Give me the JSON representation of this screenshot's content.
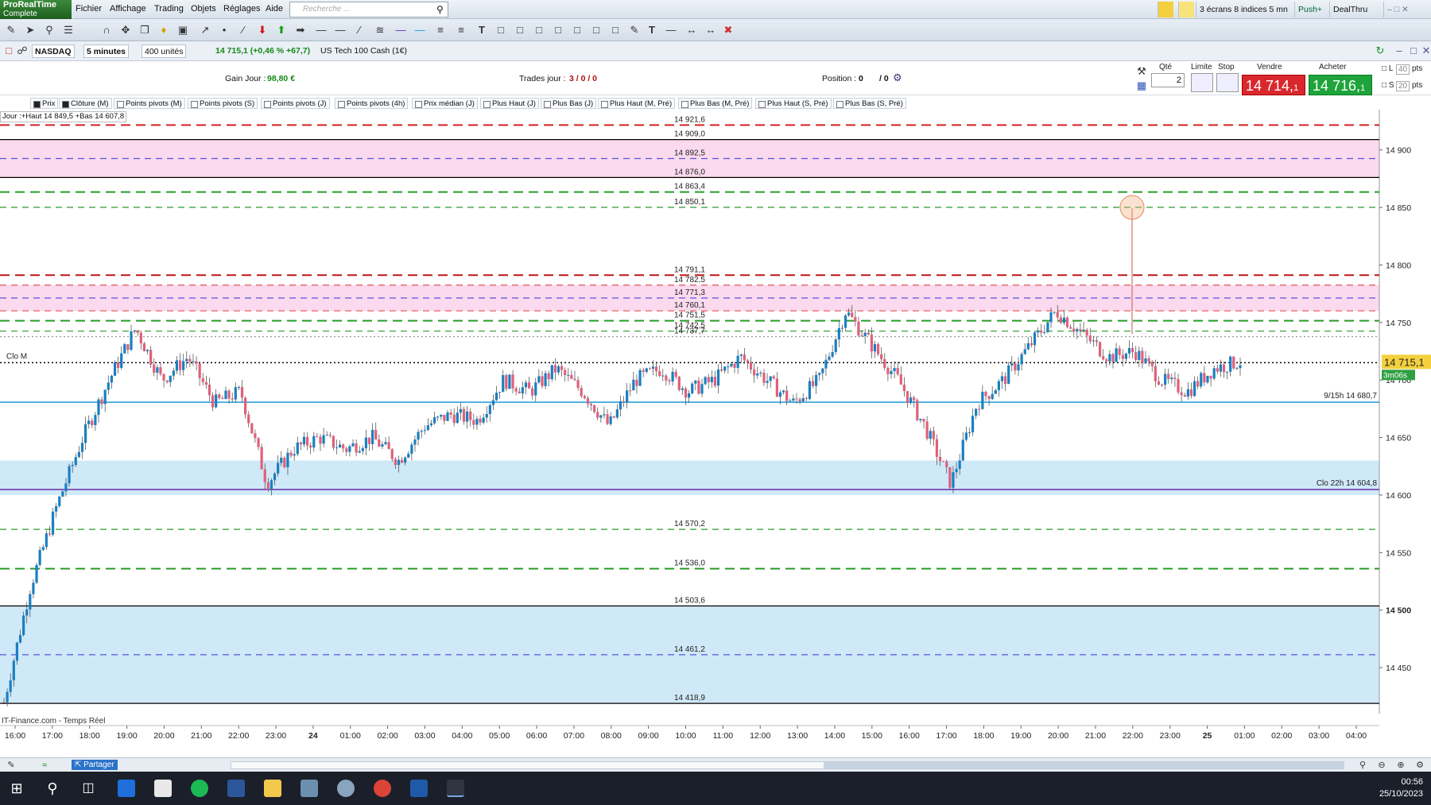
{
  "app": {
    "brand": "ProRealTime",
    "edition": "Complete"
  },
  "menu": [
    "Fichier",
    "Affichage",
    "Trading",
    "Objets",
    "Réglages",
    "Aide"
  ],
  "search": {
    "placeholder": "Recherche ..."
  },
  "topright": {
    "layout": "3 écrans 8 indices 5 mn",
    "push": "Push+",
    "dealthru": "DealThru"
  },
  "instrument": {
    "market": "NASDAQ",
    "timeframe": "5 minutes",
    "units": "400 unités",
    "quote": "14 715,1 (+0,46 % +67,7)",
    "name": "US Tech 100 Cash (1€)"
  },
  "trade": {
    "gain_label": "Gain Jour :",
    "gain_value": "98,80 €",
    "trades_label": "Trades jour :",
    "trades_value": "3 / 0 / 0",
    "position_label": "Position :",
    "position_value": "0",
    "position_extra": "/ 0",
    "qty_label": "Qté",
    "qty_value": "2",
    "limit_label": "Limite",
    "stop_label": "Stop",
    "sell_label": "Vendre",
    "buy_label": "Acheter",
    "sell_price": "14 714,",
    "sell_price_small": "1",
    "buy_price": "14 716,",
    "buy_price_small": "1",
    "l_label": "L",
    "s_label": "S",
    "l_pts": "40",
    "s_pts": "20",
    "pts": "pts"
  },
  "legend": [
    "Prix",
    "Clôture (M)",
    "Points pivots (M)",
    "Points pivots (S)",
    "Points pivots (J)",
    "Points pivots (4h)",
    "Prix médian (J)",
    "Plus Haut (J)",
    "Plus Bas (J)",
    "Plus Haut (M, Pré)",
    "Plus Bas (M, Pré)",
    "Plus Haut (S, Pré)",
    "Plus Bas (S, Pré)"
  ],
  "day_info": "Jour :+Haut 14 849,5 +Bas 14 607,8",
  "chart_data": {
    "type": "candlestick",
    "y_axis": {
      "min": 14410,
      "max": 14935,
      "ticks": [
        "14 900",
        "14 850",
        "14 800",
        "14 750",
        "14 700",
        "14 650",
        "14 600",
        "14 550",
        "14 500",
        "14 450"
      ],
      "tick_values": [
        14900,
        14850,
        14800,
        14750,
        14700,
        14650,
        14600,
        14550,
        14500,
        14450
      ]
    },
    "x_axis": {
      "labels": [
        "16:00",
        "17:00",
        "18:00",
        "19:00",
        "20:00",
        "21:00",
        "22:00",
        "23:00",
        "24",
        "01:00",
        "02:00",
        "03:00",
        "04:00",
        "05:00",
        "06:00",
        "07:00",
        "08:00",
        "09:00",
        "10:00",
        "11:00",
        "12:00",
        "13:00",
        "14:00",
        "15:00",
        "16:00",
        "17:00",
        "18:00",
        "19:00",
        "20:00",
        "21:00",
        "22:00",
        "23:00",
        "25",
        "01:00",
        "02:00",
        "03:00",
        "04:00"
      ]
    },
    "levels": [
      {
        "value": 14921.6,
        "label": "14 921,6",
        "color": "#d62020",
        "style": "dash-long"
      },
      {
        "value": 14909.0,
        "label": "14 909,0",
        "color": "#000000",
        "style": "solid"
      },
      {
        "value": 14892.5,
        "label": "14 892,5",
        "color": "#5555dd",
        "style": "dash"
      },
      {
        "value": 14876.0,
        "label": "14 876,0",
        "color": "#000000",
        "style": "solid"
      },
      {
        "value": 14863.4,
        "label": "14 863,4",
        "color": "#2a9a2a",
        "style": "dash-long"
      },
      {
        "value": 14850.1,
        "label": "14 850,1",
        "color": "#2a9a2a",
        "style": "dash"
      },
      {
        "value": 14791.1,
        "label": "14 791,1",
        "color": "#c01515",
        "style": "dash-long"
      },
      {
        "value": 14782.5,
        "label": "14 782,5",
        "color": "#e05555",
        "style": "dash"
      },
      {
        "value": 14771.3,
        "label": "14 771,3",
        "color": "#5555dd",
        "style": "dash"
      },
      {
        "value": 14760.1,
        "label": "14 760,1",
        "color": "#e05555",
        "style": "dash"
      },
      {
        "value": 14751.5,
        "label": "14 751,5",
        "color": "#2a9a2a",
        "style": "dash-long"
      },
      {
        "value": 14742.5,
        "label": "14 742,5",
        "color": "#2a9a2a",
        "style": "dash"
      },
      {
        "value": 14737.7,
        "label": "14 737,7",
        "color": "#999999",
        "style": "dot"
      },
      {
        "value": 14570.2,
        "label": "14 570,2",
        "color": "#2a9a2a",
        "style": "dash"
      },
      {
        "value": 14536.0,
        "label": "14 536,0",
        "color": "#2a9a2a",
        "style": "dash-long"
      },
      {
        "value": 14503.6,
        "label": "14 503,6",
        "color": "#000000",
        "style": "solid"
      },
      {
        "value": 14461.2,
        "label": "14 461,2",
        "color": "#5555dd",
        "style": "dash"
      },
      {
        "value": 14418.9,
        "label": "14 418,9",
        "color": "#000000",
        "style": "solid"
      }
    ],
    "zones": [
      {
        "from": 14876.0,
        "to": 14909.0,
        "color": "#fbd9ee"
      },
      {
        "from": 14760.1,
        "to": 14782.5,
        "color": "#fbd9ee"
      },
      {
        "from": 14600.0,
        "to": 14630.0,
        "color": "#cfe9f8"
      },
      {
        "from": 14418.9,
        "to": 14503.6,
        "color": "#cfe9f8"
      }
    ],
    "annotations": [
      {
        "value": 14715.1,
        "label": "Clo M",
        "color": "#000000",
        "style": "dot"
      },
      {
        "value": 14680.7,
        "label": "9/15h 14 680,7",
        "color": "#1a9bd7",
        "style": "solid"
      },
      {
        "value": 14604.8,
        "label": "Clo 22h 14 604,8",
        "color": "#6a2aa8",
        "style": "solid"
      }
    ],
    "current_price": {
      "value": 14715.1,
      "label": "14 715,1",
      "timer": "3m06s"
    },
    "series": [
      {
        "close_path": [
          14420,
          14520,
          14590,
          14650,
          14700,
          14745,
          14700,
          14720,
          14680,
          14690,
          14610,
          14640,
          14650,
          14640,
          14650,
          14630,
          14660,
          14670,
          14665,
          14700,
          14690,
          14710,
          14690,
          14660,
          14700,
          14710,
          14690,
          14700,
          14720,
          14700,
          14680,
          14700,
          14760,
          14730,
          14700,
          14660,
          14610,
          14680,
          14700,
          14730,
          14760,
          14740,
          14720,
          14725,
          14700,
          14690,
          14710,
          14716
        ]
      }
    ]
  },
  "footer": {
    "source": "IT-Finance.com - Temps Réel",
    "share": "Partager"
  },
  "clock": {
    "time": "00:56",
    "date": "25/10/2023"
  }
}
